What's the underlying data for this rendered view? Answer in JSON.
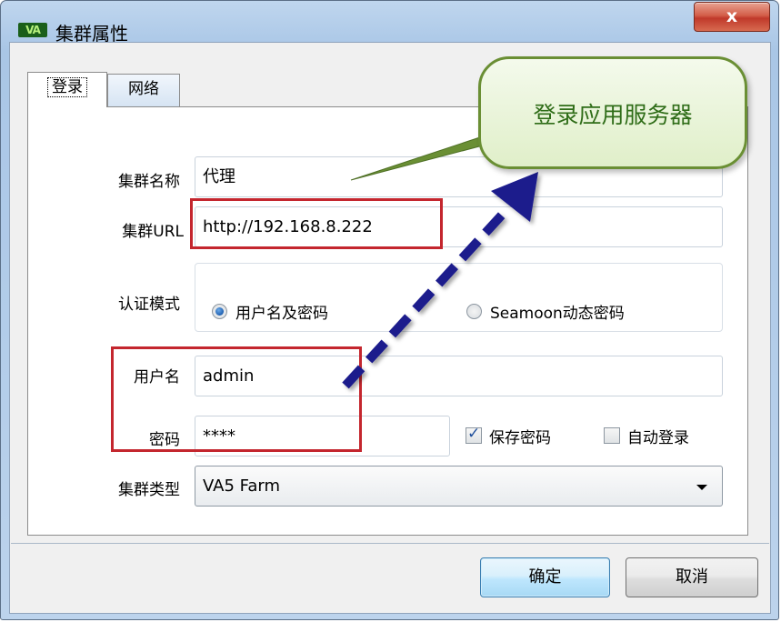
{
  "window": {
    "title": "集群属性",
    "app_icon_text": "VA",
    "close_glyph": "x"
  },
  "tabs": [
    {
      "label": "登录",
      "active": true
    },
    {
      "label": "网络",
      "active": false
    }
  ],
  "form": {
    "cluster_name": {
      "label": "集群名称",
      "value": "代理"
    },
    "cluster_url": {
      "label": "集群URL",
      "value": "http://192.168.8.222"
    },
    "auth_mode": {
      "label": "认证模式",
      "options": [
        {
          "label": "用户名及密码",
          "selected": true
        },
        {
          "label": "Seamoon动态密码",
          "selected": false
        }
      ]
    },
    "username": {
      "label": "用户名",
      "value": "admin"
    },
    "password": {
      "label": "密码",
      "value": "****"
    },
    "save_password": {
      "label": "保存密码",
      "checked": true
    },
    "auto_login": {
      "label": "自动登录",
      "checked": false
    },
    "cluster_type": {
      "label": "集群类型",
      "value": "VA5 Farm"
    }
  },
  "buttons": {
    "ok": "确定",
    "cancel": "取消"
  },
  "annotation": {
    "callout_text": "登录应用服务器",
    "colors": {
      "red_box": "#c4262e",
      "callout_border": "#6a8f34",
      "arrow": "#1a1a8c"
    }
  }
}
